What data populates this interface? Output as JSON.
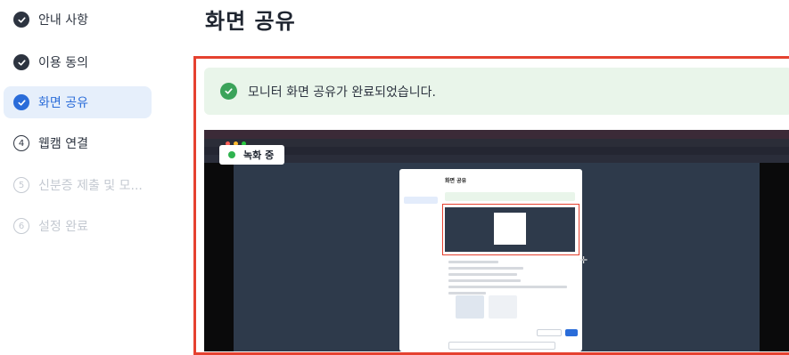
{
  "page": {
    "title": "화면 공유"
  },
  "steps": [
    {
      "label": "안내 사항",
      "status": "done",
      "index": "1"
    },
    {
      "label": "이용 동의",
      "status": "done",
      "index": "2"
    },
    {
      "label": "화면 공유",
      "status": "active",
      "index": "3"
    },
    {
      "label": "웹캠 연결",
      "status": "todo",
      "index": "4"
    },
    {
      "label": "신분증 제출 및 모...",
      "status": "disabled",
      "index": "5"
    },
    {
      "label": "설정 완료",
      "status": "disabled",
      "index": "6"
    }
  ],
  "banner": {
    "text": "모니터 화면 공유가 완료되었습니다.",
    "icon": "check-circle-icon"
  },
  "preview": {
    "recording_label": "녹화 중",
    "mini_title": "화면 공유"
  },
  "colors": {
    "accent": "#2a6cd9",
    "success": "#3ba35a",
    "frame": "#e5412f",
    "banner_bg": "#e9f5ea"
  }
}
